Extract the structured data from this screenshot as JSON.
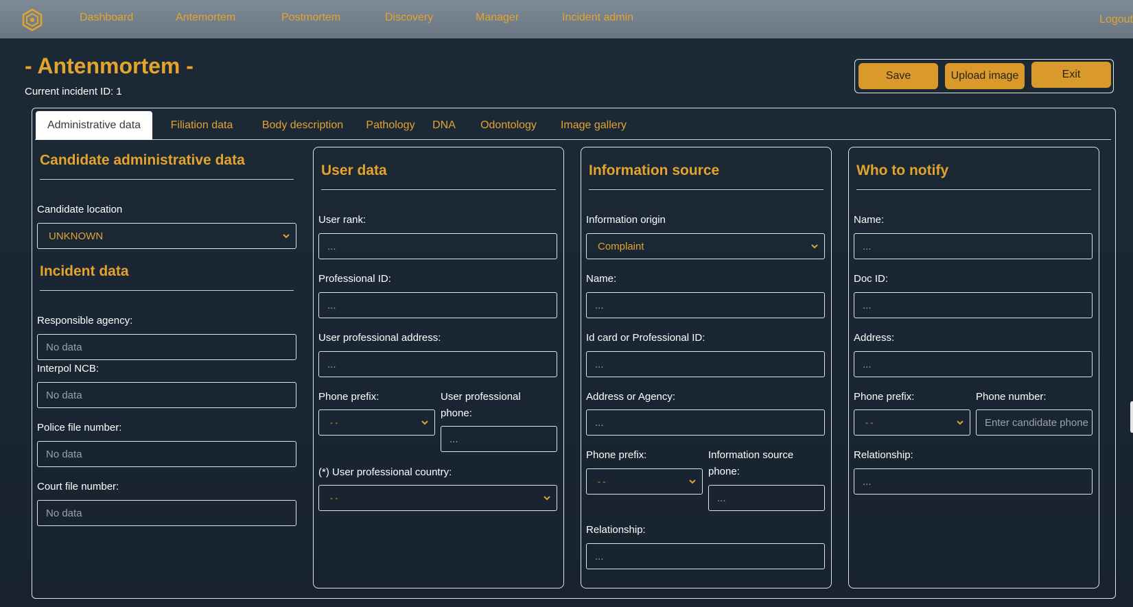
{
  "nav": {
    "items": [
      "Dashboard",
      "Antemortem",
      "Postmortem",
      "Discovery",
      "Manager",
      "Incident admin"
    ],
    "logout": "Logout"
  },
  "header": {
    "title": "- Antenmortem -",
    "incident_label": "Current incident ID:",
    "incident_value": "1"
  },
  "actions": {
    "save": "Save",
    "upload": "Upload image",
    "exit": "Exit"
  },
  "tabs": [
    "Administrative data",
    "Filiation data",
    "Body description",
    "Pathology",
    "DNA",
    "Odontology",
    "Image gallery"
  ],
  "candidate": {
    "title": "Candidate administrative data",
    "location_label": "Candidate location",
    "location_value": "UNKNOWN"
  },
  "incident": {
    "title": "Incident data",
    "agency_label": "Responsible agency:",
    "agency_ph": "No data",
    "ncb_label": "Interpol NCB:",
    "ncb_ph": "No data",
    "police_label": "Police file number:",
    "police_ph": "No data",
    "court_label": "Court file number:",
    "court_ph": "No data"
  },
  "user": {
    "title": "User data",
    "rank_label": "User rank:",
    "rank_ph": "...",
    "profid_label": "Professional ID:",
    "profid_ph": "...",
    "address_label": "User professional address:",
    "address_ph": "...",
    "prefix_label": "Phone prefix:",
    "prefix_value": "- -",
    "phone_label": "User professional phone:",
    "phone_ph": "...",
    "country_label": "(*) User professional country:",
    "country_value": "- -"
  },
  "source": {
    "title": "Information source",
    "origin_label": "Information origin",
    "origin_value": "Complaint",
    "name_label": "Name:",
    "name_ph": "...",
    "idcard_label": "Id card or Professional ID:",
    "idcard_ph": "...",
    "address_label": "Address or Agency:",
    "address_ph": "...",
    "prefix_label": "Phone prefix:",
    "prefix_value": "- -",
    "phone_label": "Information source phone:",
    "phone_ph": "...",
    "relationship_label": "Relationship:",
    "relationship_ph": "..."
  },
  "notify": {
    "title": "Who to notify",
    "name_label": "Name:",
    "name_ph": "...",
    "docid_label": "Doc ID:",
    "docid_ph": "...",
    "address_label": "Address:",
    "address_ph": "...",
    "prefix_label": "Phone prefix:",
    "prefix_value": "- -",
    "phone_label": "Phone number:",
    "phone_ph": "Enter candidate phone",
    "relationship_label": "Relationship:",
    "relationship_ph": "..."
  },
  "colors": {
    "accent": "#e3a42e",
    "button": "#d99a2b",
    "background": "#1b2733",
    "navbar": "#76828e"
  }
}
